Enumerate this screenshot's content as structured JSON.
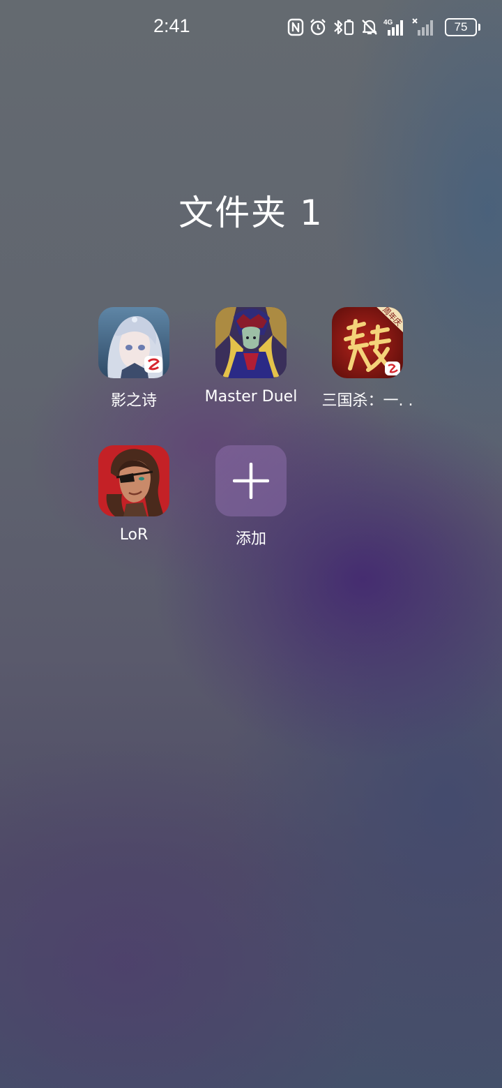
{
  "status_bar": {
    "time": "2:41",
    "network": "4G",
    "battery_level": "75"
  },
  "folder": {
    "title": "文件夹 1"
  },
  "apps": [
    {
      "label": "影之诗",
      "icon": "shadowverse-icon"
    },
    {
      "label": "Master Duel",
      "icon": "master-duel-icon"
    },
    {
      "label": "三国杀：一. .",
      "icon": "sanguosha-icon",
      "badge": "周年庆"
    },
    {
      "label": "LoR",
      "icon": "lor-icon"
    }
  ],
  "add_button": {
    "label": "添加"
  },
  "colors": {
    "text": "#ffffff",
    "add_tile": "#8c6eaa"
  }
}
